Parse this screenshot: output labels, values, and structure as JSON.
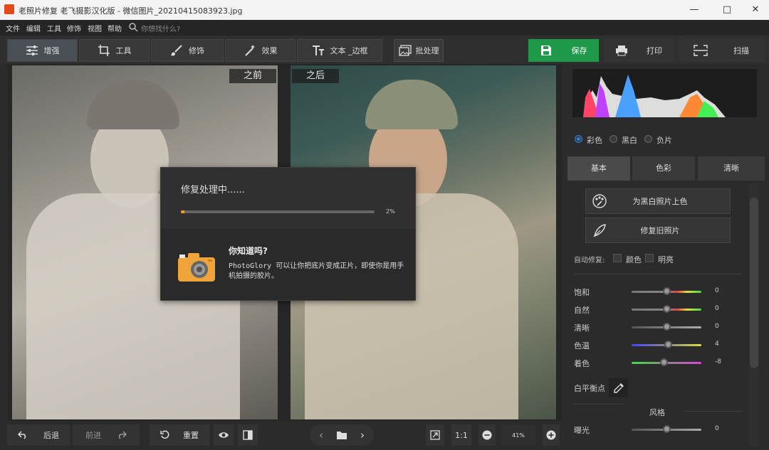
{
  "window": {
    "title": "老照片修复 老飞摄影汉化版 - 微信图片_20210415083923.jpg"
  },
  "menu": {
    "items": [
      "文件",
      "编辑",
      "工具",
      "修饰",
      "视图",
      "帮助"
    ],
    "search_placeholder": "你想找什么?"
  },
  "tabs": [
    {
      "label": "增强",
      "icon": "sliders-icon"
    },
    {
      "label": "工具",
      "icon": "crop-icon"
    },
    {
      "label": "修饰",
      "icon": "brush-icon"
    },
    {
      "label": "效果",
      "icon": "magic-wand-icon"
    },
    {
      "label": "文本 _边框",
      "icon": "text-icon"
    }
  ],
  "toolbar": {
    "batch_label": "批处理",
    "save_label": "保存",
    "print_label": "打印",
    "scan_label": "扫描"
  },
  "canvas": {
    "before_label": "之前",
    "after_label": "之后"
  },
  "dialog": {
    "title": "修复处理中......",
    "progress": 2,
    "progress_text": "2%",
    "tip_title": "你知道吗?",
    "tip_body": "PhotoGlory 可以让你把底片变成正片，即使你是用手机拍摄的胶片。"
  },
  "bottom": {
    "undo_label": "后退",
    "redo_label": "前进",
    "reset_label": "重置",
    "ratio_label": "1:1",
    "zoom_value": "41%"
  },
  "panel": {
    "modes": [
      "彩色",
      "黑白",
      "负片"
    ],
    "tabs": [
      "基本",
      "色彩",
      "清晰"
    ],
    "colorize_label": "为黑白照片上色",
    "restore_label": "修复旧照片",
    "auto_fix_label": "自动修复:",
    "auto_fix_options": [
      "颜色",
      "明亮"
    ],
    "sliders": [
      {
        "label": "饱和",
        "value": "0"
      },
      {
        "label": "自然",
        "value": "0"
      },
      {
        "label": "清晰",
        "value": "0"
      },
      {
        "label": "色温",
        "value": "4"
      },
      {
        "label": "着色",
        "value": "-8"
      }
    ],
    "white_balance_label": "白平衡点",
    "style_heading": "风格",
    "exposure": {
      "label": "曝光",
      "value": "0"
    }
  },
  "colors": {
    "accent_green": "#1e9a4a",
    "progress": "#e8a13a",
    "radio_on": "#2b7bd9"
  }
}
